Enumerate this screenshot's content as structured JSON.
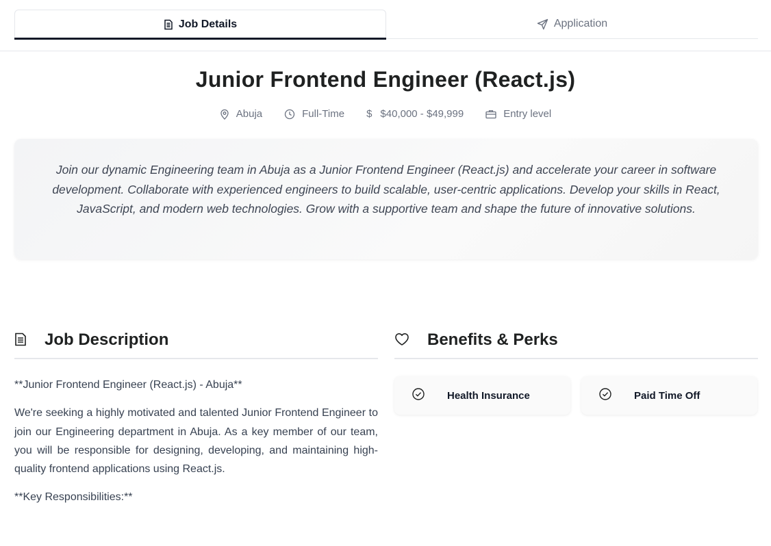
{
  "tabs": [
    {
      "label": "Job Details",
      "icon": "document-icon",
      "active": true
    },
    {
      "label": "Application",
      "icon": "send-icon",
      "active": false
    }
  ],
  "job": {
    "title": "Junior Frontend Engineer (React.js)",
    "location": "Abuja",
    "employment_type": "Full-Time",
    "currency_symbol": "$",
    "salary": "$40,000 - $49,999",
    "level": "Entry level",
    "summary": "Join our dynamic Engineering team in Abuja as a Junior Frontend Engineer (React.js) and accelerate your career in software development. Collaborate with experienced engineers to build scalable, user-centric applications. Develop your skills in React, JavaScript, and modern web technologies. Grow with a supportive team and shape the future of innovative solutions."
  },
  "description": {
    "heading": "Job Description",
    "paragraphs": [
      "**Junior Frontend Engineer (React.js) - Abuja**",
      "We're seeking a highly motivated and talented Junior Frontend Engineer to join our Engineering department in Abuja. As a key member of our team, you will be responsible for designing, developing, and maintaining high-quality frontend applications using React.js.",
      "**Key Responsibilities:**"
    ]
  },
  "benefits": {
    "heading": "Benefits & Perks",
    "items": [
      "Health Insurance",
      "Paid Time Off"
    ]
  },
  "colors": {
    "primary_text": "#1f2121",
    "muted_text": "#6b7280",
    "active_tab_underline": "#111827",
    "divider": "#e5e7eb"
  }
}
